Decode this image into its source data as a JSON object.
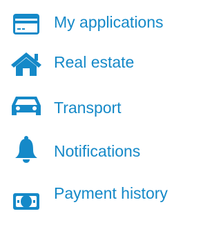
{
  "colors": {
    "accent": "#1589c8",
    "icon": "#1589c8",
    "background": "#ffffff"
  },
  "menu": {
    "items": [
      {
        "label": "My applications",
        "icon": "credit-card-icon"
      },
      {
        "label": "Real estate",
        "icon": "house-icon"
      },
      {
        "label": "Transport",
        "icon": "car-icon"
      },
      {
        "label": "Notifications",
        "icon": "bell-icon"
      },
      {
        "label": "Payment history",
        "icon": "banknote-icon"
      }
    ]
  }
}
